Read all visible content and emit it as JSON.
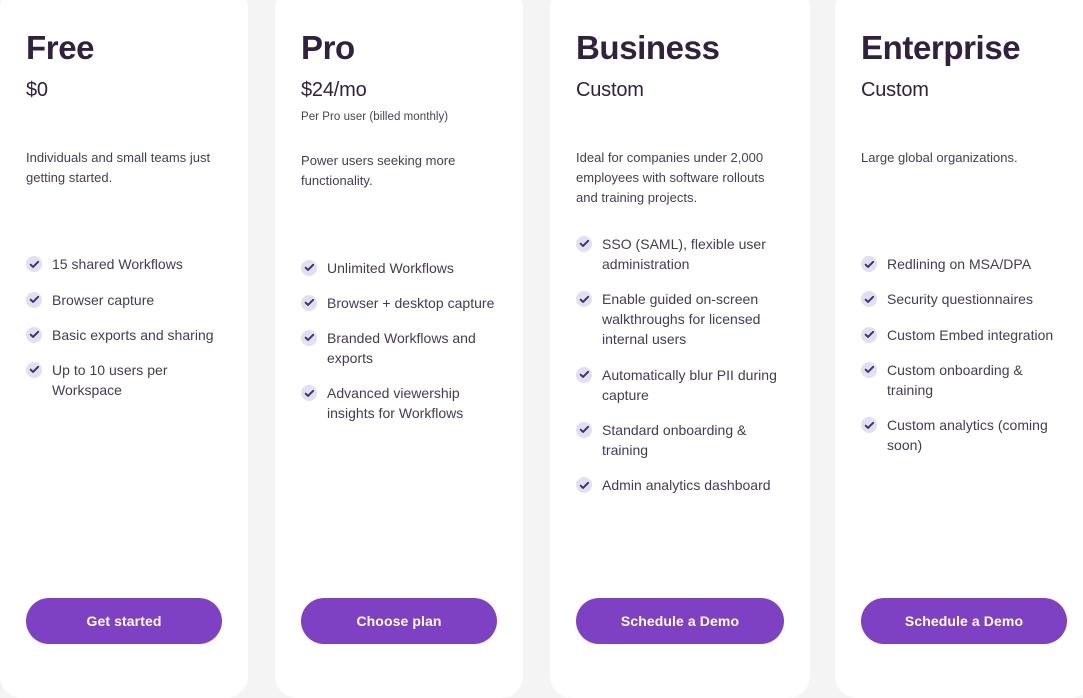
{
  "accent_color": "#7f41c4",
  "heading_color": "#31203f",
  "body_color": "#473c58",
  "check_bg_color": "#e3dff0",
  "check_mark_color": "#3b3270",
  "highlight_card_gradient": [
    "#ffffff",
    "#fbeeea",
    "#e6ddf3"
  ],
  "plans": [
    {
      "name": "Free",
      "price": "$0",
      "price_note": "",
      "description": "Individuals and small teams just getting started.",
      "features": [
        "15 shared Workflows",
        "Browser capture",
        "Basic exports and sharing",
        "Up to 10 users per Workspace"
      ],
      "cta_label": "Get started",
      "highlighted": false
    },
    {
      "name": "Pro",
      "price": "$24/mo",
      "price_note": "Per Pro user (billed monthly)",
      "description": "Power users seeking more functionality.",
      "features": [
        "Unlimited Workflows",
        "Browser + desktop capture",
        "Branded Workflows and exports",
        "Advanced viewership insights for Workflows"
      ],
      "cta_label": "Choose plan",
      "highlighted": false
    },
    {
      "name": "Business",
      "price": "Custom",
      "price_note": "",
      "description": "Ideal for companies under 2,000 employees with software rollouts and training projects.",
      "features": [
        "SSO (SAML), flexible user administration",
        "Enable guided on-screen walkthroughs for licensed internal users",
        "Automatically blur PII during capture",
        "Standard onboarding & training",
        "Admin analytics dashboard"
      ],
      "cta_label": "Schedule a Demo",
      "highlighted": true
    },
    {
      "name": "Enterprise",
      "price": "Custom",
      "price_note": "",
      "description": "Large global organizations.",
      "features": [
        "Redlining on MSA/DPA",
        "Security questionnaires",
        "Custom Embed integration",
        "Custom onboarding & training",
        "Custom analytics (coming soon)"
      ],
      "cta_label": "Schedule a Demo",
      "highlighted": false
    }
  ]
}
